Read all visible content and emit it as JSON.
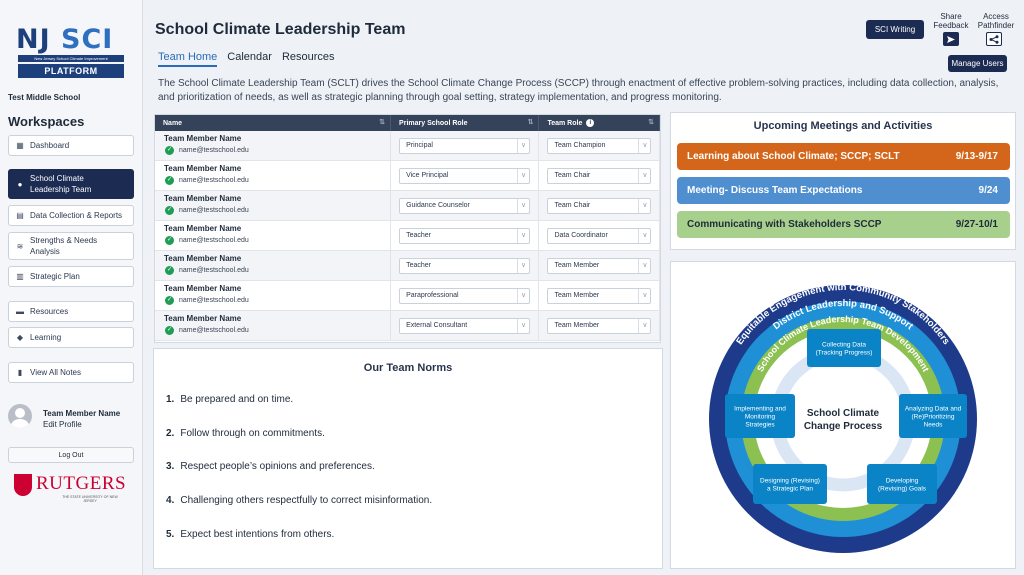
{
  "brand": {
    "logo_main": "NJ ",
    "logo_sci": "SCI",
    "logo_sub": "New Jersey School Climate Improvement",
    "logo_platform": "PLATFORM",
    "school_name": "Test Middle School"
  },
  "sidebar": {
    "heading": "Workspaces",
    "items": [
      {
        "label": "Dashboard",
        "icon": "grid-icon"
      },
      {
        "label": "School Climate Leadership Team",
        "icon": "people-icon"
      },
      {
        "label": "Data Collection & Reports",
        "icon": "report-icon"
      },
      {
        "label": "Strengths & Needs Analysis",
        "icon": "layers-icon"
      },
      {
        "label": "Strategic Plan",
        "icon": "chart-icon"
      },
      {
        "label": "Resources",
        "icon": "folder-icon"
      },
      {
        "label": "Learning",
        "icon": "graduation-icon"
      },
      {
        "label": "View All Notes",
        "icon": "note-icon"
      }
    ],
    "user_name": "Team Member Name",
    "edit_profile": "Edit Profile",
    "logout": "Log Out",
    "rutgers": "RUTGERS",
    "rutgers_sub": "THE STATE UNIVERSITY OF NEW JERSEY"
  },
  "header": {
    "title": "School Climate Leadership Team",
    "tabs": [
      "Team Home",
      "Calendar",
      "Resources"
    ],
    "description": "The School Climate Leadership Team (SCLT) drives the School Climate Change Process (SCCP) through enactment of effective problem-solving practices, including data collection, analysis, and prioritization of needs, as well as strategic planning through goal setting, strategy implementation, and progress monitoring.",
    "sci_writing": "SCI Writing",
    "share_feedback": "Share Feedback",
    "access_pathfinder": "Access Pathfinder",
    "manage_users": "Manage Users"
  },
  "team_table": {
    "headers": [
      "Name",
      "Primary School Role",
      "Team Role"
    ],
    "rows": [
      {
        "name": "Team Member Name",
        "email": "name@testschool.edu",
        "role": "Principal",
        "team_role": "Team Champion"
      },
      {
        "name": "Team Member Name",
        "email": "name@testschool.edu",
        "role": "Vice Principal",
        "team_role": "Team Chair"
      },
      {
        "name": "Team Member Name",
        "email": "name@testschool.edu",
        "role": "Guidance Counselor",
        "team_role": "Team Chair"
      },
      {
        "name": "Team Member Name",
        "email": "name@testschool.edu",
        "role": "Teacher",
        "team_role": "Data Coordinator"
      },
      {
        "name": "Team Member Name",
        "email": "name@testschool.edu",
        "role": "Teacher",
        "team_role": "Team Member"
      },
      {
        "name": "Team Member Name",
        "email": "name@testschool.edu",
        "role": "Paraprofessional",
        "team_role": "Team Member"
      },
      {
        "name": "Team Member Name",
        "email": "name@testschool.edu",
        "role": "External Consultant",
        "team_role": "Team Member"
      }
    ]
  },
  "norms": {
    "title": "Our Team Norms",
    "items": [
      {
        "num": "1.",
        "text": "Be prepared and on time."
      },
      {
        "num": "2.",
        "text": "Follow through on commitments."
      },
      {
        "num": "3.",
        "text": "Respect people’s opinions and preferences."
      },
      {
        "num": "4.",
        "text": "Challenging others respectfully to correct misinformation."
      },
      {
        "num": "5.",
        "text": "Expect best intentions from others."
      }
    ]
  },
  "meetings": {
    "title": "Upcoming Meetings and Activities",
    "items": [
      {
        "label": "Learning about School Climate; SCCP; SCLT",
        "date": "9/13-9/17",
        "color": "#d4661b",
        "text_color": "#ffffff"
      },
      {
        "label": "Meeting- Discuss Team Expectations",
        "date": "9/24",
        "color": "#4f8fd0",
        "text_color": "#ffffff"
      },
      {
        "label": "Communicating with Stakeholders SCCP",
        "date": "9/27-10/1",
        "color": "#a8d08d",
        "text_color": "#1f2a3a"
      }
    ]
  },
  "diagram": {
    "ring_outer": "Equitable Engagement with Community Stakeholders",
    "ring_middle": "District Leadership and Support",
    "ring_inner": "School Climate Leadership Team Development",
    "center": [
      "School Climate",
      "Change Process"
    ],
    "steps": [
      [
        "Collecting Data",
        "(Tracking Progress)"
      ],
      [
        "Analyzing Data and",
        "(Re)Prioritizing",
        "Needs"
      ],
      [
        "Developing",
        "(Revising) Goals"
      ],
      [
        "Designing (Revising)",
        "a Strategic Plan"
      ],
      [
        "Implementing and",
        "Monitoring",
        "Strategies"
      ]
    ],
    "colors": {
      "outer": "#1e3a8a",
      "middle": "#1f8fd6",
      "inner": "#8cc152",
      "box": "#0a84c6"
    }
  }
}
